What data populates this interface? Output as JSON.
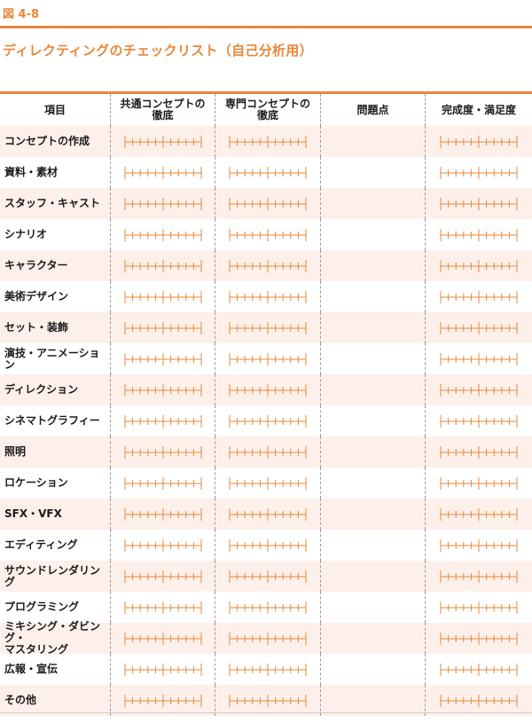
{
  "figure_label": "図 4-8",
  "title": "ディレクティングのチェックリスト（自己分析用）",
  "table": {
    "headers": [
      "項目",
      "共通コンセプトの\n徹底",
      "専門コンセプトの\n徹底",
      "問題点",
      "完成度・満足度"
    ],
    "rows": [
      "コンセプトの作成",
      "資料・素材",
      "スタッフ・キャスト",
      "シナリオ",
      "キャラクター",
      "美術デザイン",
      "セット・装飾",
      "演技・アニメーション",
      "ディレクション",
      "シネマトグラフィー",
      "照明",
      "ロケーション",
      "SFX・VFX",
      "エディティング",
      "サウンドレンダリング",
      "プログラミング",
      "ミキシング・ダビング・\nマスタリング",
      "広報・宣伝",
      "その他"
    ]
  },
  "colors": {
    "accent": "#e8873a",
    "stripe": "#fdf0ea",
    "divider": "#9a9a9a"
  }
}
